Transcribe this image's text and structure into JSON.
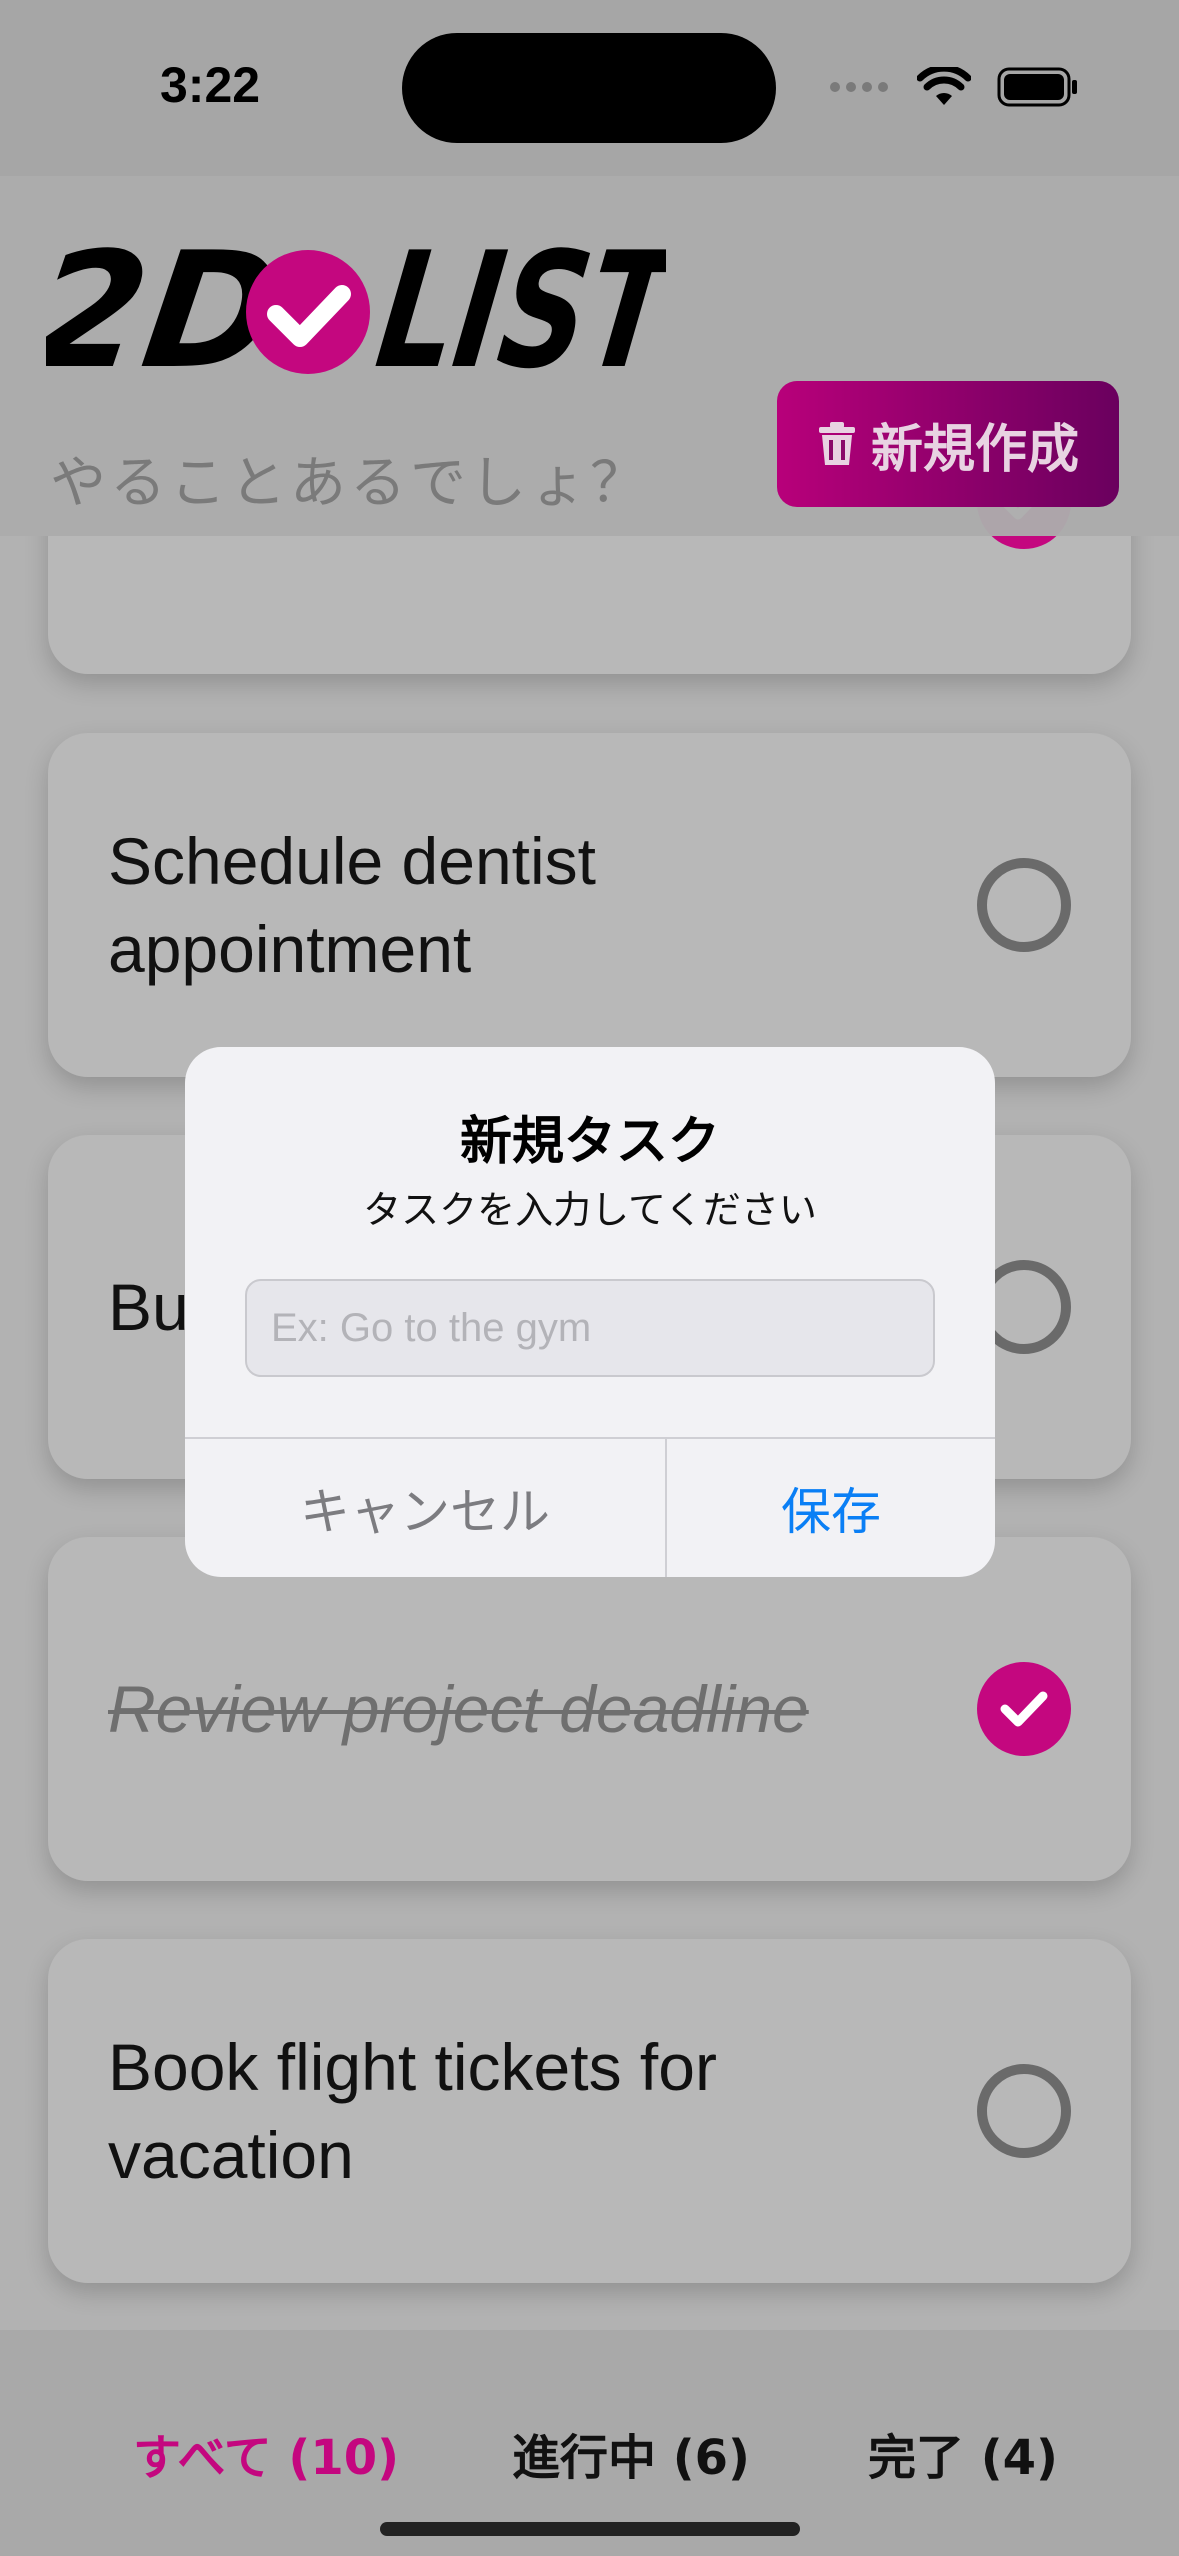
{
  "status_bar": {
    "time": "3:22"
  },
  "header": {
    "logo_left": "2D",
    "logo_right": "LIST",
    "subtitle": "やることあるでしょ？",
    "new_button_label": "新規作成"
  },
  "tasks": [
    {
      "text": "",
      "done": true
    },
    {
      "text": "Schedule dentist appointment",
      "done": false
    },
    {
      "text": "Bu",
      "done": false
    },
    {
      "text": "Review project deadline",
      "done": true
    },
    {
      "text": "Book flight tickets for vacation",
      "done": false
    }
  ],
  "tabs": [
    {
      "label": "すべて (10)",
      "active": true
    },
    {
      "label": "進行中 (6)",
      "active": false
    },
    {
      "label": "完了 (4)",
      "active": false
    }
  ],
  "dialog": {
    "title": "新規タスク",
    "message": "タスクを入力してください",
    "input_placeholder": "Ex: Go to the gym",
    "input_value": "",
    "cancel_label": "キャンセル",
    "save_label": "保存"
  },
  "colors": {
    "accent": "#c4077f",
    "link_blue": "#0a7ff5"
  }
}
